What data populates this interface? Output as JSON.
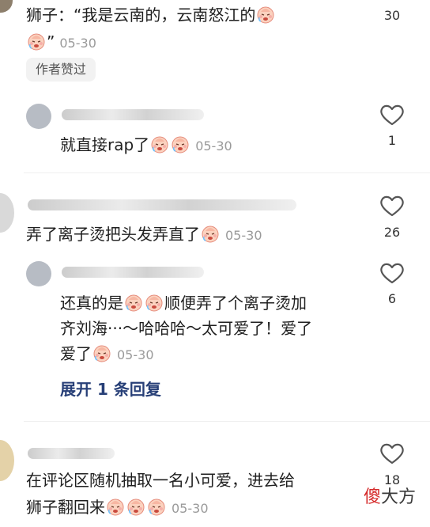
{
  "colors": {
    "link": "#273f77",
    "time": "#9a9a9a",
    "watermark": "#d52a2a"
  },
  "comments": [
    {
      "text_line1": "狮子：“我是云南的，云南怒江的",
      "text_line2": "”",
      "time": "05-30",
      "badge": "作者赞过",
      "likes": "30"
    },
    {
      "text": "就直接rap了",
      "time": "05-30",
      "likes": "1"
    },
    {
      "text": "弄了离子烫把头发弄直了",
      "time": "05-30",
      "likes": "26"
    },
    {
      "text_line1": "还真的是",
      "text_line1b": "顺便弄了个离子烫加",
      "text_line2": "齐刘海···～哈哈哈～太可爱了！爱了",
      "text_line3": "爱了",
      "time": "05-30",
      "likes": "6"
    },
    {
      "text_line1": "在评论区随机抽取一名小可爱，进去给",
      "text_line2": "狮子翻回来",
      "time": "05-30",
      "likes": "18"
    }
  ],
  "expand_replies": "展开 1 条回复",
  "watermark": {
    "part1": "傻",
    "part2": "大方"
  },
  "icons": [
    "heart-icon",
    "emoji-icon",
    "avatar"
  ]
}
